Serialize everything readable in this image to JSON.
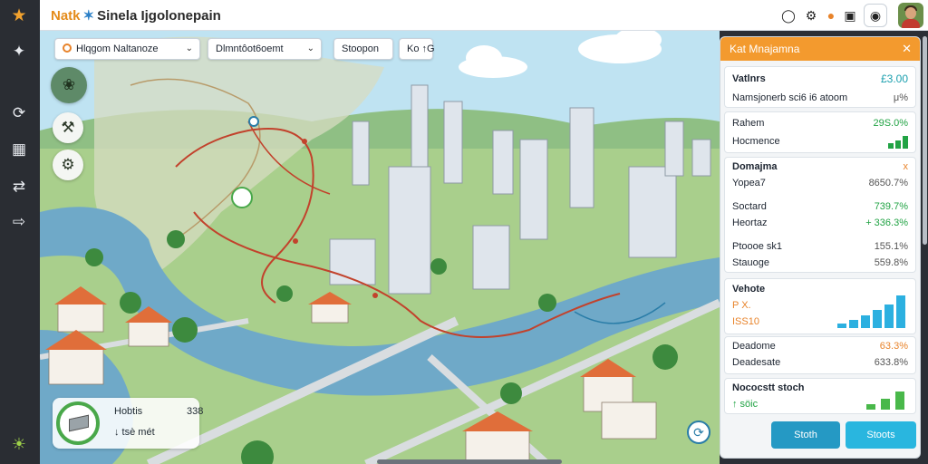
{
  "app": {
    "brand": "Natk",
    "title": "Sinela Ijgolonepain"
  },
  "rail": {
    "icons": [
      "logo-icon",
      "network-icon",
      "refresh-icon",
      "chart-icon",
      "transfer-icon",
      "export-icon",
      "sun-icon"
    ]
  },
  "topbar": {
    "icons": [
      "chat-icon",
      "gear-icon",
      "bell-icon",
      "lock-icon",
      "camera-icon",
      "avatar"
    ]
  },
  "map": {
    "dropdown1": "Hlqgom Naltanoze",
    "dropdown2": "Dlmntôot6oemt",
    "dropdown3": "Stoopon",
    "dropdown4": "Ko ↑G",
    "minicard": {
      "label1": "Hobtis",
      "label2": "↓ tsè mét",
      "value": "338"
    }
  },
  "panel": {
    "header": "Kat Mnajamna",
    "s1": {
      "title": "Vatlnrs",
      "title_value": "£3.00",
      "sub": "Namsjonerb sci6 i6 atoom",
      "sub_value": "μ%"
    },
    "s2": [
      {
        "label": "Rahem",
        "value": "29S.0%"
      },
      {
        "label": "Hocmence",
        "value": ""
      }
    ],
    "s3": {
      "title": "Domajma",
      "title_mark": "x",
      "rows": [
        {
          "label": "Yopea7",
          "value": "8650.7%"
        },
        {
          "label": "Soctard",
          "value": "739.7%"
        },
        {
          "label": "Heortaz",
          "value": "+ 336.3%"
        },
        {
          "label": "Ptoooe sk1",
          "value": "155.1%"
        },
        {
          "label": "Stauoge",
          "value": "559.8%"
        }
      ]
    },
    "s4": {
      "title": "Vehote",
      "rows": [
        {
          "label": "P X.",
          "value": ""
        },
        {
          "label": "ISS10",
          "value": ""
        }
      ]
    },
    "s5": [
      {
        "label": "Deadome",
        "value": "63.3%"
      },
      {
        "label": "Deadesate",
        "value": "633.8%"
      }
    ],
    "s6": {
      "title": "Nococstt stoch",
      "sub": "↑ söic"
    },
    "buttons": {
      "primary": "Stoth",
      "secondary": "Stoots"
    },
    "colors": {
      "accent": "#f39a2e",
      "positive": "#21a344",
      "info": "#1a9fae",
      "bars": "#2cb0e0"
    }
  }
}
